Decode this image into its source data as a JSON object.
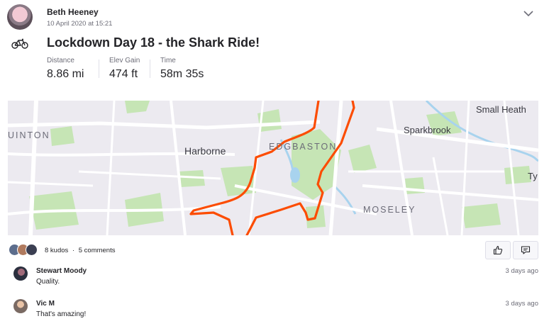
{
  "activity": {
    "athlete_name": "Beth Heeney",
    "date": "10 April 2020 at 15:21",
    "title": "Lockdown Day 18 - the Shark Ride!",
    "sport_icon": "bike-icon",
    "stats": [
      {
        "label": "Distance",
        "value": "8.86 mi"
      },
      {
        "label": "Elev Gain",
        "value": "474 ft"
      },
      {
        "label": "Time",
        "value": "58m 35s"
      }
    ]
  },
  "map": {
    "route_color": "#fc4c02",
    "labels": {
      "small_heath": "Small Heath",
      "sparkbrook": "Sparkbrook",
      "edgbaston": "EDGBASTON",
      "harborne": "Harborne",
      "quinton": "UINTON",
      "moseley": "MOSELEY",
      "tyseley": "Ty"
    }
  },
  "social": {
    "kudos_count": "8 kudos",
    "separator": "·",
    "comments_count": "5 comments",
    "kudos_icon": "thumbs-up-icon",
    "comment_icon": "comment-icon"
  },
  "comments": [
    {
      "name": "Stewart Moody",
      "text": "Quality.",
      "time": "3 days ago"
    },
    {
      "name": "Vic M",
      "text": "That's amazing!",
      "time": "3 days ago"
    }
  ],
  "colors": {
    "brand": "#fc4c02",
    "park": "#c6e5b5",
    "water": "#a8d3ee",
    "text": "#242428",
    "muted": "#6d6d78"
  }
}
